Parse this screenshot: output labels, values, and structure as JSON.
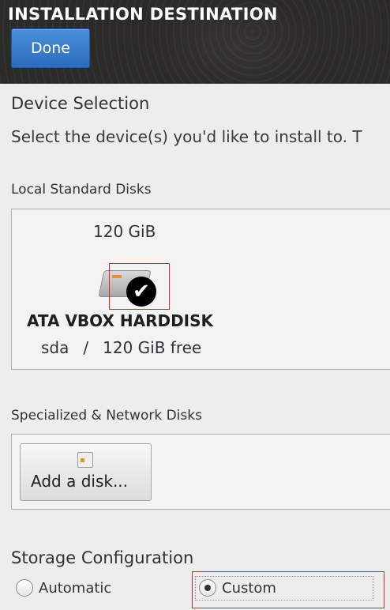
{
  "header": {
    "title": "INSTALLATION DESTINATION",
    "done_label": "Done"
  },
  "device_selection": {
    "title": "Device Selection",
    "description": "Select the device(s) you'd like to install to.  T"
  },
  "local_disks": {
    "title": "Local Standard Disks",
    "disks": [
      {
        "size": "120 GiB",
        "name": "ATA VBOX HARDDISK",
        "device": "sda",
        "separator": "/",
        "free": "120 GiB free",
        "selected": true,
        "icon": "hard-disk-icon",
        "check_icon": "checkmark-icon"
      }
    ]
  },
  "specialized": {
    "title": "Specialized & Network Disks",
    "add_disk_label": "Add a disk...",
    "add_disk_icon": "add-disk-icon"
  },
  "storage": {
    "title": "Storage Configuration",
    "options": [
      {
        "label": "Automatic",
        "checked": false
      },
      {
        "label": "Custom",
        "checked": true
      }
    ]
  },
  "colors": {
    "accent": "#2c6cbd",
    "highlight": "#d42a2a",
    "header_bg": "#2b2a28",
    "background": "#ededed"
  }
}
